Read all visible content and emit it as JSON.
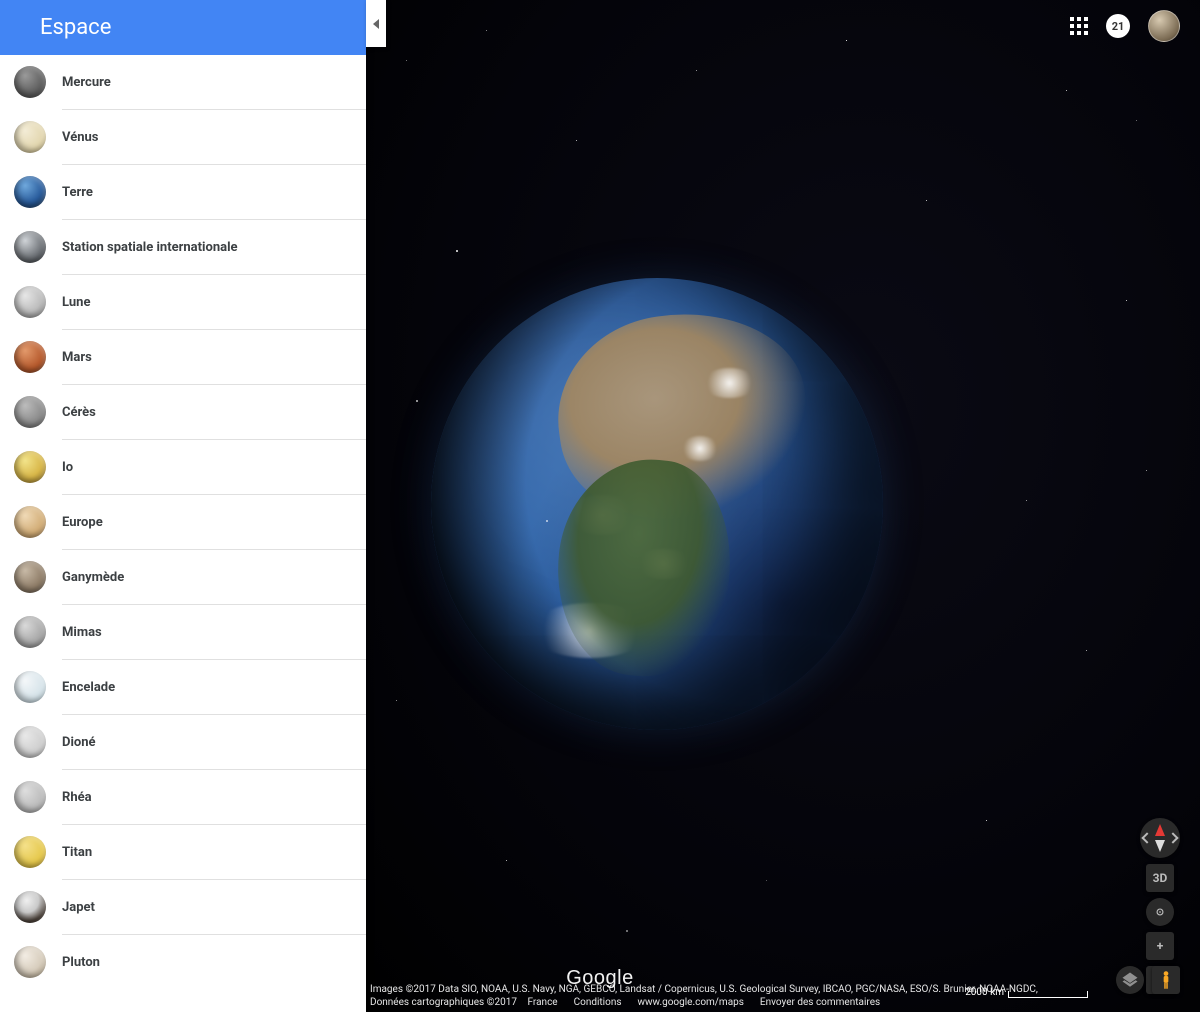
{
  "sidebar": {
    "title": "Espace",
    "items": [
      {
        "label": "Mercure",
        "thumb": "radial-gradient(circle at 35% 30%,#9a9a9a,#555 70%,#2b2b2b)"
      },
      {
        "label": "Vénus",
        "thumb": "radial-gradient(circle at 35% 30%,#f3ecd6,#e3d7b0 60%,#b8a874)"
      },
      {
        "label": "Terre",
        "thumb": "radial-gradient(circle at 35% 30%,#6fa8dc,#2b5e9e 55%,#0b2544)"
      },
      {
        "label": "Station spatiale internationale",
        "thumb": "radial-gradient(circle at 35% 30%,#cfd3d7,#6b6f74 60%,#1b1f24)"
      },
      {
        "label": "Lune",
        "thumb": "radial-gradient(circle at 35% 30%,#e6e6e6,#bdbdbd 55%,#7a7a7a)"
      },
      {
        "label": "Mars",
        "thumb": "radial-gradient(circle at 35% 30%,#e2996b,#b65a2d 60%,#6b2f12)"
      },
      {
        "label": "Cérès",
        "thumb": "radial-gradient(circle at 35% 30%,#bcbcbc,#8b8b8b 60%,#4e4e4e)"
      },
      {
        "label": "Io",
        "thumb": "radial-gradient(circle at 35% 30%,#f2e38a,#d9b84a 55%,#8a6a1e)"
      },
      {
        "label": "Europe",
        "thumb": "radial-gradient(circle at 35% 30%,#efd9b6,#d3ae78 60%,#9a7445)"
      },
      {
        "label": "Ganymède",
        "thumb": "radial-gradient(circle at 35% 30%,#c7b9a6,#8f7d68 60%,#4f4336)"
      },
      {
        "label": "Mimas",
        "thumb": "radial-gradient(circle at 35% 30%,#d9d9d9,#a8a8a8 60%,#6b6b6b)"
      },
      {
        "label": "Encelade",
        "thumb": "radial-gradient(circle at 35% 30%,#f4f7f9,#d7e4ea 60%,#a9bfc8)"
      },
      {
        "label": "Dioné",
        "thumb": "radial-gradient(circle at 35% 30%,#e8e8e8,#cfcfcf 60%,#9d9d9d)"
      },
      {
        "label": "Rhéa",
        "thumb": "radial-gradient(circle at 35% 30%,#dedede,#bcbcbc 60%,#8c8c8c)"
      },
      {
        "label": "Titan",
        "thumb": "radial-gradient(circle at 35% 30%,#f4e08a,#e6c94e 60%,#b89520)"
      },
      {
        "label": "Japet",
        "thumb": "radial-gradient(circle at 40% 30%,#efefef,#c9c9c9 40%,#4a4038 70%,#1f1812)"
      },
      {
        "label": "Pluton",
        "thumb": "radial-gradient(circle at 35% 30%,#f2ece3,#d7cdbd 55%,#a59579)"
      }
    ]
  },
  "header": {
    "notification_count": "21"
  },
  "controls": {
    "view_mode": "3D",
    "zoom_in": "+",
    "zoom_out": "−"
  },
  "footer": {
    "logo": "Google",
    "attribution_line": "Images ©2017 Data SIO, NOAA, U.S. Navy, NGA, GEBCO, Landsat / Copernicus, U.S. Geological Survey, IBCAO, PGC/NASA, ESO/S. Brunier, NOAA-NGDC, Données cartographiques ©2017",
    "links": [
      "France",
      "Conditions",
      "www.google.com/maps",
      "Envoyer des commentaires"
    ],
    "scale_label": "2000 km"
  }
}
